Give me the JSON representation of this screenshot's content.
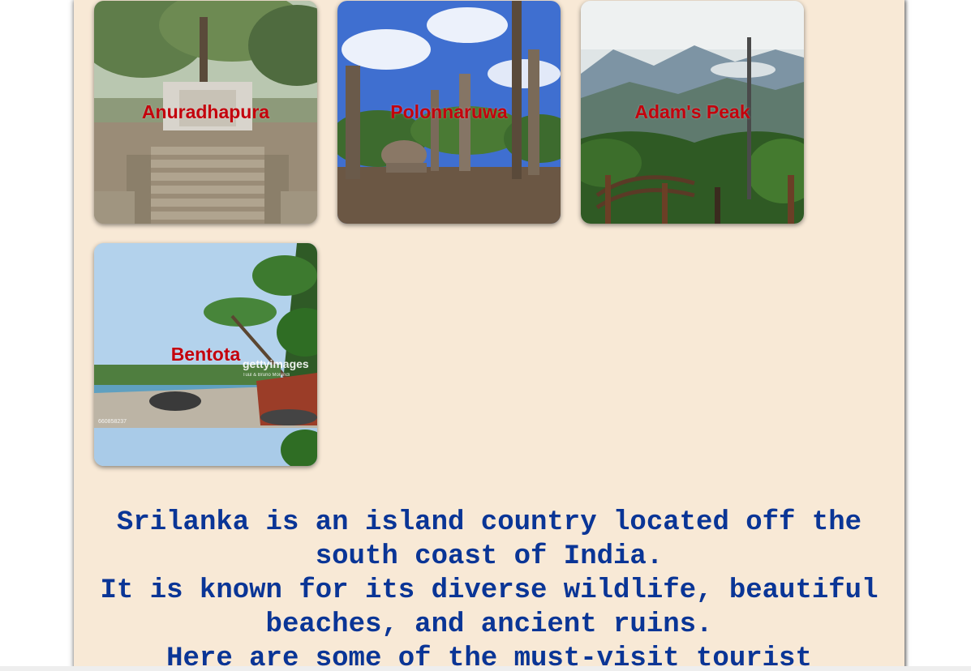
{
  "destinations": [
    {
      "name": "Anuradhapura",
      "image": "ancient stupa temple steps with trees"
    },
    {
      "name": "Polonnaruwa",
      "image": "ruins with stone pillars under blue sky"
    },
    {
      "name": "Adam's Peak",
      "image": "mountain view with forest and railing"
    },
    {
      "name": "Bentota",
      "image": "palm-lined beach with rocks and sea"
    }
  ],
  "intro": {
    "line1": "Srilanka is an island country located off the south coast of India.",
    "line2": "It is known for its diverse wildlife, beautiful beaches, and ancient ruins.",
    "line3": "Here are some of the must-visit tourist"
  },
  "watermarks": {
    "getty": "gettyimages",
    "getty_credit": "Tuul & Bruno Morandi",
    "getty_id": "660858237"
  },
  "colors": {
    "page_background": "#f8e9d6",
    "title_red": "#c4000c",
    "intro_blue": "#0a3596"
  }
}
